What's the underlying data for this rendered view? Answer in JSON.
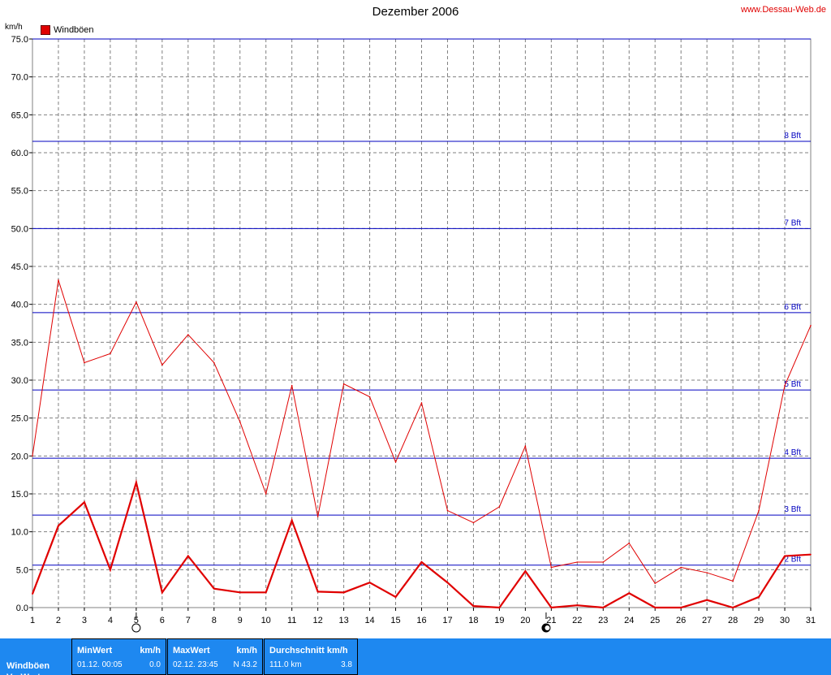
{
  "header": {
    "title": "Dezember 2006",
    "site": "www.Dessau-Web.de",
    "unit": "km/h",
    "legend_label": "Windböen"
  },
  "chart_data": {
    "type": "line",
    "x_categories": [
      "1",
      "2",
      "3",
      "4",
      "5",
      "6",
      "7",
      "8",
      "9",
      "10",
      "11",
      "12",
      "13",
      "14",
      "15",
      "16",
      "17",
      "18",
      "19",
      "20",
      "21",
      "22",
      "23",
      "24",
      "25",
      "26",
      "27",
      "28",
      "29",
      "30",
      "31"
    ],
    "ylim": [
      0,
      75
    ],
    "y_ticks": [
      "0.0",
      "5.0",
      "10.0",
      "15.0",
      "20.0",
      "25.0",
      "30.0",
      "35.0",
      "40.0",
      "45.0",
      "50.0",
      "55.0",
      "60.0",
      "65.0",
      "70.0",
      "75.0"
    ],
    "grid": true,
    "series": [
      {
        "name": "Windböen",
        "values": [
          20.0,
          43.2,
          32.3,
          33.5,
          40.3,
          32.0,
          36.0,
          32.3,
          24.5,
          15.0,
          29.3,
          12.0,
          29.5,
          27.8,
          19.2,
          27.0,
          12.8,
          11.2,
          13.3,
          21.3,
          5.3,
          6.0,
          6.0,
          8.5,
          3.2,
          5.3,
          4.6,
          3.5,
          12.8,
          29.3,
          37.2
        ],
        "color": "#e00000"
      },
      {
        "name": "",
        "values": [
          1.8,
          10.8,
          13.9,
          5.0,
          16.5,
          2.0,
          6.8,
          2.5,
          2.0,
          2.0,
          11.5,
          2.1,
          2.0,
          3.3,
          1.4,
          6.0,
          3.3,
          0.2,
          0.0,
          4.8,
          0.0,
          0.3,
          0.0,
          1.9,
          0.0,
          0.0,
          1.0,
          0.0,
          1.4,
          6.8,
          7.0
        ],
        "color": "#e00000"
      }
    ],
    "bft_lines": [
      {
        "label": "2 Bft",
        "value": 5.6
      },
      {
        "label": "3 Bft",
        "value": 12.2
      },
      {
        "label": "4 Bft",
        "value": 19.7
      },
      {
        "label": "5 Bft",
        "value": 28.7
      },
      {
        "label": "6 Bft",
        "value": 38.9
      },
      {
        "label": "7 Bft",
        "value": 50.0
      },
      {
        "label": "8 Bft",
        "value": 61.5
      },
      {
        "label": "",
        "value": 75.0
      }
    ],
    "moon_phases": [
      {
        "day": 5,
        "phase": "full-moon-icon"
      },
      {
        "day": 20.8,
        "phase": "new-moon-icon"
      }
    ],
    "bft_color": "#0000c0"
  },
  "footer": {
    "row_label": "Windböen",
    "row_label2": "VorWert",
    "min": {
      "header": "MinWert",
      "unit": "km/h",
      "date": "01.12.  00:05",
      "value": "0.0"
    },
    "max": {
      "header": "MaxWert",
      "unit": "km/h",
      "date": "02.12.  23:45",
      "value": "N 43.2"
    },
    "avg": {
      "header": "Durchschnitt km/h",
      "date": "111.0 km",
      "value": "3.8"
    }
  }
}
